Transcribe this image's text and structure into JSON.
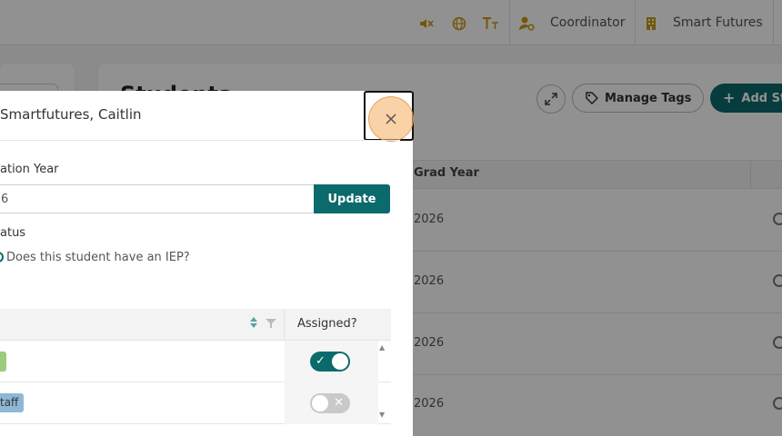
{
  "topbar": {
    "role": "Coordinator",
    "org": "Smart Futures",
    "icons": [
      "mute-icon",
      "globe-icon",
      "text-size-icon",
      "user-gear-icon",
      "building-icon"
    ]
  },
  "page": {
    "title": "Students",
    "manage_tags_label": "Manage Tags",
    "add_label": "Add St",
    "table": {
      "grad_year_header": "Grad Year",
      "rows": [
        {
          "grad_year": "2026"
        },
        {
          "grad_year": "2026"
        },
        {
          "grad_year": "2026"
        },
        {
          "grad_year": "2026"
        }
      ]
    }
  },
  "modal": {
    "title": "Smartfutures, Caitlin",
    "graduation_year_label": "ation Year",
    "graduation_year_value": "6",
    "update_label": "Update",
    "status_label": "atus",
    "iep_question": "Does this student have an IEP?",
    "tags_table": {
      "assigned_header": "Assigned?",
      "rows": [
        {
          "tag_label": "",
          "tag_color": "#9ccb7a",
          "assigned": true
        },
        {
          "tag_label": "taff",
          "tag_color": "#8fb8d6",
          "assigned": false
        }
      ]
    }
  },
  "colors": {
    "accent": "#0b6a6b",
    "icon_gold": "#c99a14",
    "highlight": "#f5b46e"
  }
}
